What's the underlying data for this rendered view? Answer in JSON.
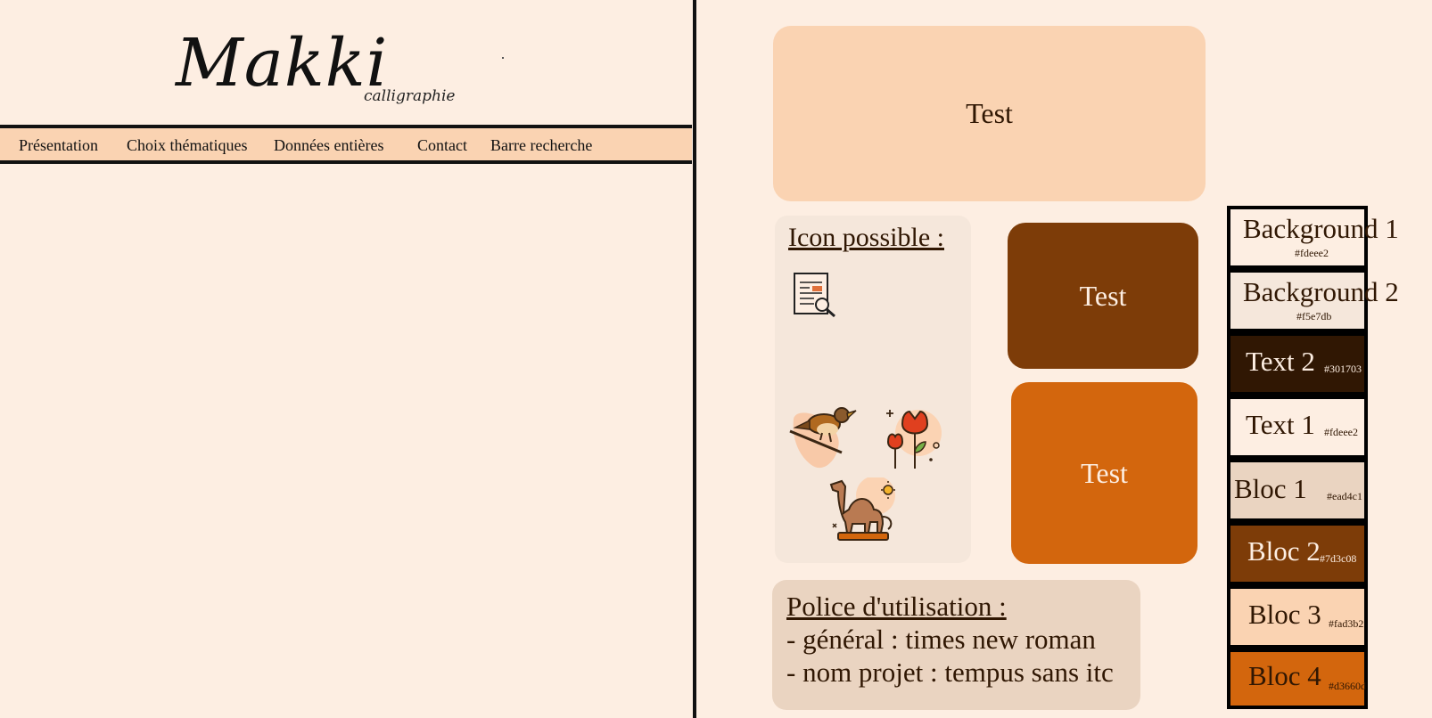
{
  "logo": {
    "title": "Makki",
    "subtitle": "calligraphie"
  },
  "nav": {
    "items": [
      "Présentation",
      "Choix thématiques",
      "Données entières",
      "Contact",
      "Barre recherche"
    ]
  },
  "cards": {
    "top": "Test",
    "middle": "Test",
    "bottom": "Test"
  },
  "icons": {
    "title": "Icon possible :",
    "list": [
      "document-search-icon",
      "bird-icon",
      "tulip-icon",
      "camel-icon"
    ]
  },
  "fonts": {
    "title": "Police d'utilisation :",
    "lines": [
      "- général : times new roman",
      "- nom projet : tempus sans itc"
    ]
  },
  "palette": [
    {
      "name": "Background 1",
      "hex": "#fdeee2",
      "bg": "#fdeee2",
      "fg": "#301703"
    },
    {
      "name": "Background 2",
      "hex": "#f5e7db",
      "bg": "#f5e7db",
      "fg": "#301703"
    },
    {
      "name": "Text 2",
      "hex": "#301703",
      "bg": "#301703",
      "fg": "#fdeee2"
    },
    {
      "name": "Text 1",
      "hex": "#fdeee2",
      "bg": "#fdeee2",
      "fg": "#301703"
    },
    {
      "name": "Bloc 1",
      "hex": "#ead4c1",
      "bg": "#ead4c1",
      "fg": "#301703"
    },
    {
      "name": "Bloc 2",
      "hex": "#7d3c08",
      "bg": "#7d3c08",
      "fg": "#fdeee2"
    },
    {
      "name": "Bloc 3",
      "hex": "#fad3b2",
      "bg": "#fad3b2",
      "fg": "#301703"
    },
    {
      "name": "Bloc 4",
      "hex": "#d3660d",
      "bg": "#d3660d",
      "fg": "#301703"
    }
  ]
}
